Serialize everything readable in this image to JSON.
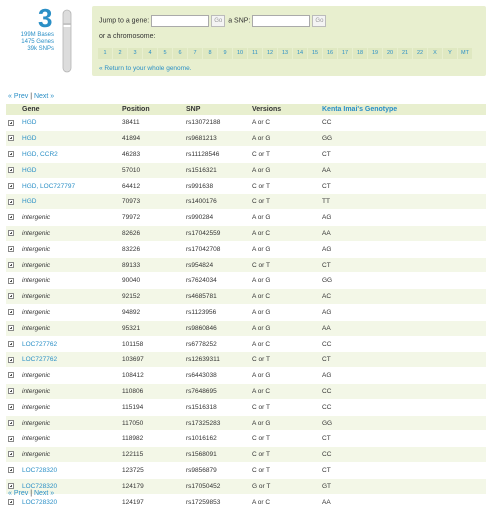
{
  "chromosome": {
    "number": "3",
    "bases": "199M Bases",
    "genes": "1475 Genes",
    "snps": "39k SNPs"
  },
  "jump": {
    "gene_label": "Jump to a gene:",
    "gene_value": "",
    "go_label": "Go",
    "snp_label": "a SNP:",
    "snp_value": "",
    "chrom_label": "or a chromosome:",
    "chromosomes": [
      "1",
      "2",
      "3",
      "4",
      "5",
      "6",
      "7",
      "8",
      "9",
      "10",
      "11",
      "12",
      "13",
      "14",
      "15",
      "16",
      "17",
      "18",
      "19",
      "20",
      "21",
      "22",
      "X",
      "Y",
      "MT"
    ],
    "return_link": "« Return to your whole genome."
  },
  "pager": {
    "prev": "« Prev",
    "sep": "|",
    "next": "Next »"
  },
  "table": {
    "headers": {
      "gene": "Gene",
      "position": "Position",
      "snp": "SNP",
      "versions": "Versions",
      "genotype": "Kenta Imai's Genotype"
    },
    "rows": [
      {
        "gene": "HGD",
        "gene_type": "link",
        "position": "38411",
        "snp": "rs13072188",
        "versions": "A or C",
        "genotype": "CC"
      },
      {
        "gene": "HGD",
        "gene_type": "link",
        "position": "41894",
        "snp": "rs9681213",
        "versions": "A or G",
        "genotype": "GG"
      },
      {
        "gene": "HGD, CCR2",
        "gene_type": "link",
        "position": "46283",
        "snp": "rs11128546",
        "versions": "C or T",
        "genotype": "CT"
      },
      {
        "gene": "HGD",
        "gene_type": "link",
        "position": "57010",
        "snp": "rs1516321",
        "versions": "A or G",
        "genotype": "AA"
      },
      {
        "gene": "HGD, LOC727797",
        "gene_type": "link",
        "position": "64412",
        "snp": "rs991638",
        "versions": "C or T",
        "genotype": "CT"
      },
      {
        "gene": "HGD",
        "gene_type": "link",
        "position": "70973",
        "snp": "rs1400176",
        "versions": "C or T",
        "genotype": "TT"
      },
      {
        "gene": "intergenic",
        "gene_type": "intergenic",
        "position": "79972",
        "snp": "rs990284",
        "versions": "A or G",
        "genotype": "AG"
      },
      {
        "gene": "intergenic",
        "gene_type": "intergenic",
        "position": "82626",
        "snp": "rs17042559",
        "versions": "A or C",
        "genotype": "AA"
      },
      {
        "gene": "intergenic",
        "gene_type": "intergenic",
        "position": "83226",
        "snp": "rs17042708",
        "versions": "A or G",
        "genotype": "AG"
      },
      {
        "gene": "intergenic",
        "gene_type": "intergenic",
        "position": "89133",
        "snp": "rs954824",
        "versions": "C or T",
        "genotype": "CT"
      },
      {
        "gene": "intergenic",
        "gene_type": "intergenic",
        "position": "90040",
        "snp": "rs7624034",
        "versions": "A or G",
        "genotype": "GG"
      },
      {
        "gene": "intergenic",
        "gene_type": "intergenic",
        "position": "92152",
        "snp": "rs4685781",
        "versions": "A or C",
        "genotype": "AC"
      },
      {
        "gene": "intergenic",
        "gene_type": "intergenic",
        "position": "94892",
        "snp": "rs1123956",
        "versions": "A or G",
        "genotype": "AG"
      },
      {
        "gene": "intergenic",
        "gene_type": "intergenic",
        "position": "95321",
        "snp": "rs9860846",
        "versions": "A or G",
        "genotype": "AA"
      },
      {
        "gene": "LOC727762",
        "gene_type": "link",
        "position": "101158",
        "snp": "rs6778252",
        "versions": "A or C",
        "genotype": "CC"
      },
      {
        "gene": "LOC727762",
        "gene_type": "link",
        "position": "103697",
        "snp": "rs12639311",
        "versions": "C or T",
        "genotype": "CT"
      },
      {
        "gene": "intergenic",
        "gene_type": "intergenic",
        "position": "108412",
        "snp": "rs6443038",
        "versions": "A or G",
        "genotype": "AG"
      },
      {
        "gene": "intergenic",
        "gene_type": "intergenic",
        "position": "110806",
        "snp": "rs7648695",
        "versions": "A or C",
        "genotype": "CC"
      },
      {
        "gene": "intergenic",
        "gene_type": "intergenic",
        "position": "115194",
        "snp": "rs1516318",
        "versions": "C or T",
        "genotype": "CC"
      },
      {
        "gene": "intergenic",
        "gene_type": "intergenic",
        "position": "117050",
        "snp": "rs17325283",
        "versions": "A or G",
        "genotype": "GG"
      },
      {
        "gene": "intergenic",
        "gene_type": "intergenic",
        "position": "118982",
        "snp": "rs1016162",
        "versions": "C or T",
        "genotype": "CT"
      },
      {
        "gene": "intergenic",
        "gene_type": "intergenic",
        "position": "122115",
        "snp": "rs1568091",
        "versions": "C or T",
        "genotype": "CC"
      },
      {
        "gene": "LOC728320",
        "gene_type": "link",
        "position": "123725",
        "snp": "rs9856879",
        "versions": "C or T",
        "genotype": "CT"
      },
      {
        "gene": "LOC728320",
        "gene_type": "link",
        "position": "124179",
        "snp": "rs17050452",
        "versions": "G or T",
        "genotype": "GT"
      },
      {
        "gene": "LOC728320",
        "gene_type": "link",
        "position": "124197",
        "snp": "rs17259853",
        "versions": "A or C",
        "genotype": "AA"
      }
    ]
  },
  "colors": {
    "accent": "#2a8fc6",
    "panel": "#e8efcf",
    "row_alt": "#f3f7e7"
  },
  "icons": {
    "chromosome": "chromosome-icon",
    "expand": "expand-plus-icon"
  }
}
